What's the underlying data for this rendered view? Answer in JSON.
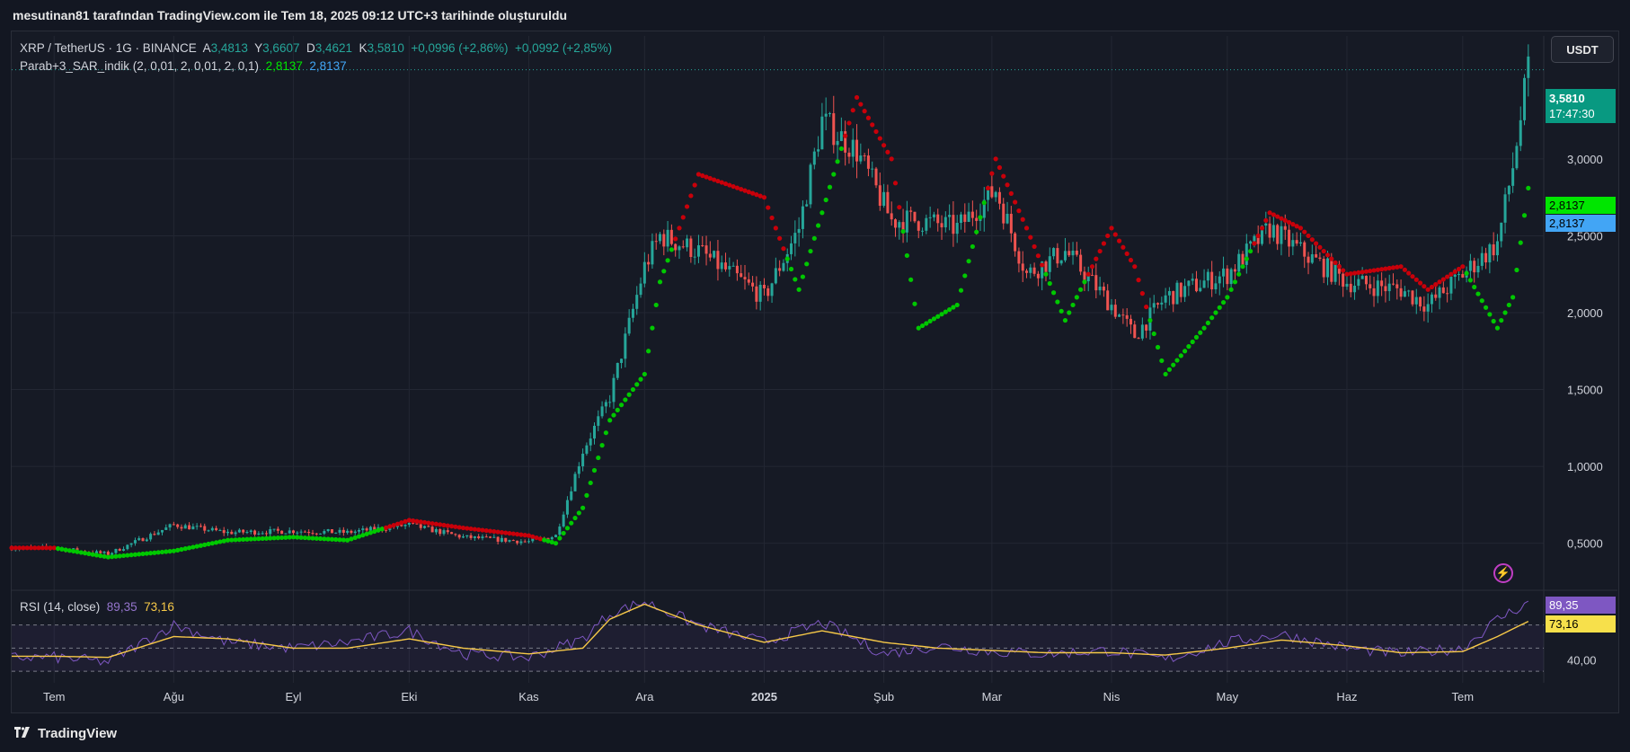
{
  "caption": "mesutinan81 tarafından TradingView.com ile Tem 18, 2025 09:12 UTC+3 tarihinde oluşturuldu",
  "legend": {
    "symbol": "XRP / TetherUS · 1G · BINANCE",
    "a_label": "A",
    "a_value": "3,4813",
    "y_label": "Y",
    "y_value": "3,6607",
    "d_label": "D",
    "d_value": "3,4621",
    "k_label": "K",
    "k_value": "3,5810",
    "change1": "+0,0996 (+2,86%)",
    "change2": "+0,0992 (+2,85%)",
    "indicator": "Parab+3_SAR_indik (2, 0,01, 2, 0,01, 2, 0,1)",
    "ind_value1": "2,8137",
    "ind_value2": "2,8137",
    "rsi": "RSI (14, close)",
    "rsi_value": "89,35",
    "rsi_ma_value": "73,16"
  },
  "currency_button": "USDT",
  "price_tag": {
    "price": "3,5810",
    "countdown": "17:47:30"
  },
  "sar_tag1": "2,8137",
  "sar_tag2": "2,8137",
  "rsi_tag1": "89,35",
  "rsi_tag2": "73,16",
  "footer_brand": "TradingView",
  "colors": {
    "up": "#26a69a",
    "down": "#ef5350",
    "sar_up": "#00c800",
    "sar_down": "#c8000a",
    "rsi": "#7e57c2",
    "rsi_ma": "#f7c948",
    "background": "#161a25",
    "grid": "#232733"
  },
  "chart_data": [
    {
      "type": "line",
      "title": "XRP / TetherUS · 1G · BINANCE",
      "ylim": [
        0.2,
        3.8
      ],
      "yticks": [
        "0,5000",
        "1,0000",
        "1,5000",
        "2,0000",
        "2,5000",
        "3,0000"
      ],
      "ytick_values": [
        0.5,
        1.0,
        1.5,
        2.0,
        2.5,
        3.0
      ],
      "xticks": [
        "Tem",
        "Ağu",
        "Eyl",
        "Eki",
        "Kas",
        "Ara",
        "2025",
        "Şub",
        "Mar",
        "Nis",
        "May",
        "Haz",
        "Tem"
      ],
      "x": [
        "2024-07-01",
        "2024-07-15",
        "2024-08-01",
        "2024-08-15",
        "2024-09-01",
        "2024-09-15",
        "2024-10-01",
        "2024-10-15",
        "2024-11-01",
        "2024-11-08",
        "2024-11-15",
        "2024-11-22",
        "2024-12-01",
        "2024-12-05",
        "2024-12-15",
        "2025-01-01",
        "2025-01-10",
        "2025-01-16",
        "2025-01-25",
        "2025-02-03",
        "2025-02-10",
        "2025-02-20",
        "2025-03-02",
        "2025-03-10",
        "2025-03-20",
        "2025-04-01",
        "2025-04-07",
        "2025-04-15",
        "2025-04-25",
        "2025-05-01",
        "2025-05-12",
        "2025-05-20",
        "2025-06-01",
        "2025-06-15",
        "2025-06-22",
        "2025-07-01",
        "2025-07-10",
        "2025-07-14",
        "2025-07-18"
      ],
      "series": [
        {
          "values": [
            0.47,
            0.43,
            0.62,
            0.57,
            0.58,
            0.57,
            0.62,
            0.54,
            0.51,
            0.55,
            1.1,
            1.45,
            2.3,
            2.5,
            2.4,
            2.1,
            2.55,
            3.25,
            3.05,
            2.6,
            2.6,
            2.55,
            2.8,
            2.25,
            2.4,
            2.05,
            1.85,
            2.1,
            2.2,
            2.25,
            2.55,
            2.4,
            2.2,
            2.15,
            2.05,
            2.25,
            2.45,
            2.95,
            3.58
          ]
        },
        {
          "name": "Parab+3_SAR_indik",
          "values": [
            0.47,
            0.41,
            0.45,
            0.52,
            0.54,
            0.52,
            0.65,
            0.6,
            0.55,
            0.5,
            0.73,
            1.3,
            1.6,
            2.2,
            2.9,
            2.75,
            2.15,
            2.65,
            3.4,
            3.0,
            1.9,
            2.05,
            3.0,
            2.55,
            1.95,
            2.55,
            2.3,
            1.6,
            1.9,
            2.1,
            2.65,
            2.55,
            2.25,
            2.3,
            2.15,
            2.3,
            1.9,
            2.1,
            2.81
          ]
        }
      ]
    },
    {
      "type": "line",
      "title": "RSI (14, close)",
      "ylim": [
        20,
        100
      ],
      "yticks": [
        "40,00"
      ],
      "ytick_values": [
        40
      ],
      "guides": [
        30,
        50,
        70
      ],
      "x": [
        "2024-07-01",
        "2024-07-15",
        "2024-08-01",
        "2024-08-15",
        "2024-09-01",
        "2024-09-15",
        "2024-10-01",
        "2024-10-15",
        "2024-11-01",
        "2024-11-15",
        "2024-11-22",
        "2024-12-01",
        "2024-12-15",
        "2025-01-01",
        "2025-01-16",
        "2025-02-01",
        "2025-02-15",
        "2025-03-01",
        "2025-03-15",
        "2025-04-01",
        "2025-04-15",
        "2025-05-01",
        "2025-05-15",
        "2025-06-01",
        "2025-06-15",
        "2025-07-01",
        "2025-07-10",
        "2025-07-18"
      ],
      "series": [
        {
          "name": "RSI",
          "values": [
            42,
            38,
            70,
            55,
            50,
            55,
            65,
            45,
            42,
            58,
            80,
            90,
            70,
            55,
            72,
            45,
            52,
            47,
            45,
            48,
            40,
            55,
            62,
            50,
            45,
            50,
            75,
            89.35
          ]
        },
        {
          "name": "MA",
          "values": [
            43,
            42,
            60,
            58,
            50,
            50,
            58,
            50,
            45,
            50,
            75,
            88,
            70,
            55,
            65,
            55,
            50,
            48,
            46,
            46,
            44,
            50,
            57,
            52,
            46,
            47,
            60,
            73.16
          ]
        }
      ]
    }
  ]
}
